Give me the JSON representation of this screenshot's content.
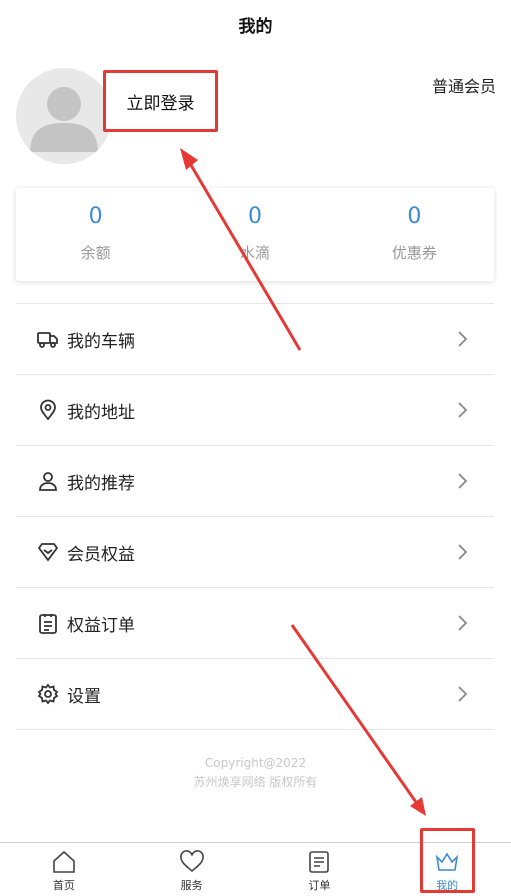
{
  "header": {
    "title": "我的"
  },
  "profile": {
    "login_label": "立即登录",
    "member_level": "普通会员"
  },
  "stats": [
    {
      "value": "0",
      "label": "余额"
    },
    {
      "value": "0",
      "label": "水滴"
    },
    {
      "value": "0",
      "label": "优惠券"
    }
  ],
  "menu": [
    {
      "label": "我的车辆",
      "icon": "truck-icon"
    },
    {
      "label": "我的地址",
      "icon": "location-pin-icon"
    },
    {
      "label": "我的推荐",
      "icon": "person-icon"
    },
    {
      "label": "会员权益",
      "icon": "diamond-icon"
    },
    {
      "label": "权益订单",
      "icon": "clipboard-icon"
    },
    {
      "label": "设置",
      "icon": "gear-icon"
    }
  ],
  "footer": {
    "copyright_line1": "Copyright@2022",
    "copyright_line2": "苏州焕享网络 版权所有"
  },
  "tabbar": [
    {
      "label": "首页",
      "icon": "home-icon"
    },
    {
      "label": "服务",
      "icon": "heart-icon"
    },
    {
      "label": "订单",
      "icon": "document-icon"
    },
    {
      "label": "我的",
      "icon": "crown-icon",
      "active": true
    }
  ],
  "colors": {
    "accent": "#3b8ad9",
    "annotation": "#e53935"
  }
}
